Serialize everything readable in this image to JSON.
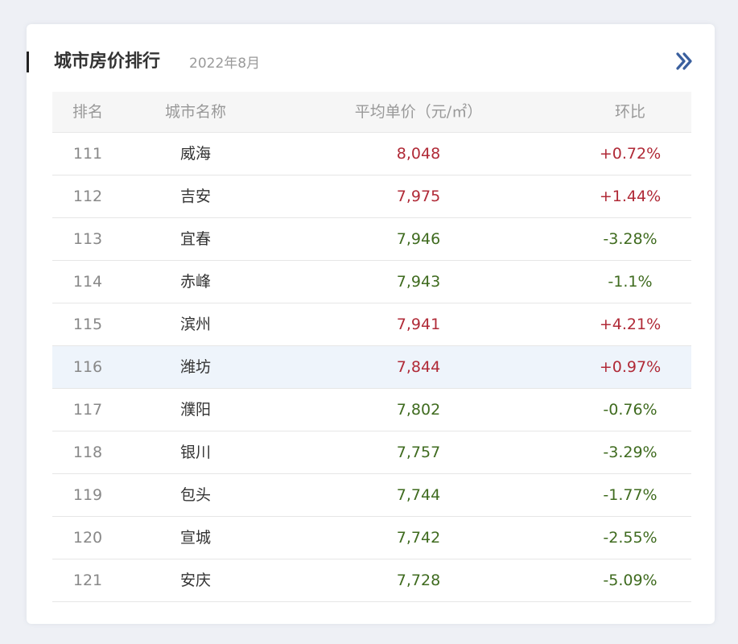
{
  "header": {
    "title": "城市房价排行",
    "date": "2022年8月",
    "more_icon": "double-chevron-right-icon"
  },
  "table": {
    "columns": [
      "排名",
      "城市名称",
      "平均单价（元/㎡）",
      "环比"
    ],
    "rows": [
      {
        "rank": "111",
        "city": "威海",
        "price": "8,048",
        "change": "+0.72%",
        "trend": "up"
      },
      {
        "rank": "112",
        "city": "吉安",
        "price": "7,975",
        "change": "+1.44%",
        "trend": "up"
      },
      {
        "rank": "113",
        "city": "宜春",
        "price": "7,946",
        "change": "-3.28%",
        "trend": "down"
      },
      {
        "rank": "114",
        "city": "赤峰",
        "price": "7,943",
        "change": "-1.1%",
        "trend": "down"
      },
      {
        "rank": "115",
        "city": "滨州",
        "price": "7,941",
        "change": "+4.21%",
        "trend": "up"
      },
      {
        "rank": "116",
        "city": "潍坊",
        "price": "7,844",
        "change": "+0.97%",
        "trend": "up",
        "highlighted": true
      },
      {
        "rank": "117",
        "city": "濮阳",
        "price": "7,802",
        "change": "-0.76%",
        "trend": "down"
      },
      {
        "rank": "118",
        "city": "银川",
        "price": "7,757",
        "change": "-3.29%",
        "trend": "down"
      },
      {
        "rank": "119",
        "city": "包头",
        "price": "7,744",
        "change": "-1.77%",
        "trend": "down"
      },
      {
        "rank": "120",
        "city": "宣城",
        "price": "7,742",
        "change": "-2.55%",
        "trend": "down"
      },
      {
        "rank": "121",
        "city": "安庆",
        "price": "7,728",
        "change": "-5.09%",
        "trend": "down"
      }
    ]
  },
  "colors": {
    "up": "#b02a37",
    "down": "#3f6b1f",
    "accent": "#3a5f9e",
    "highlight_row": "#eef4fb"
  }
}
